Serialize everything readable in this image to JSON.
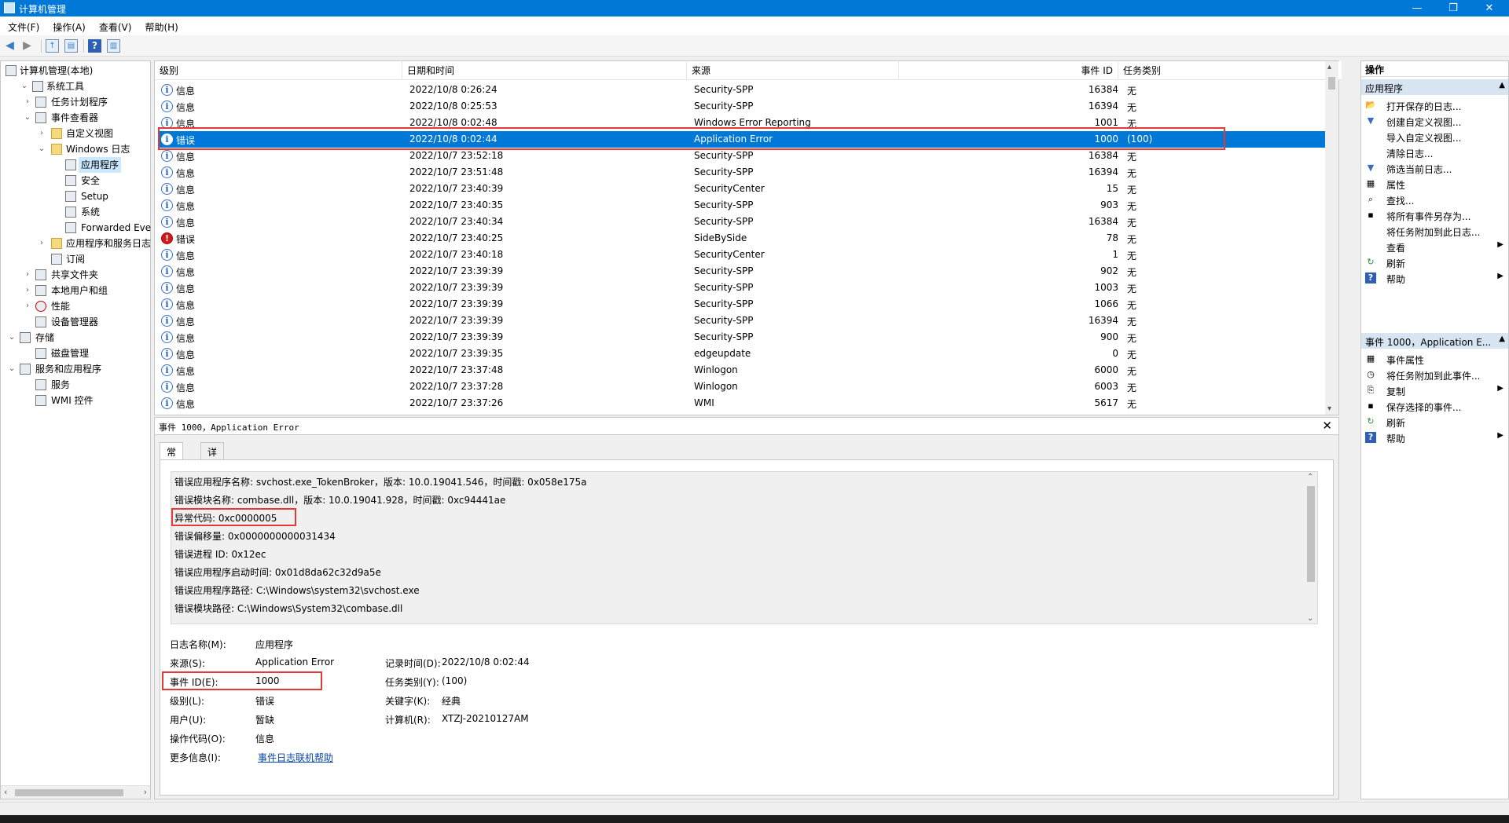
{
  "window": {
    "title": "计算机管理",
    "minimize_glyph": "—",
    "restore_glyph": "❐",
    "close_glyph": "✕"
  },
  "menu": [
    "文件(F)",
    "操作(A)",
    "查看(V)",
    "帮助(H)"
  ],
  "tree": {
    "items": [
      {
        "label": "计算机管理(本地)",
        "icon": "computer-management-icon"
      },
      {
        "label": "系统工具",
        "icon": "tools-icon"
      },
      {
        "label": "任务计划程序",
        "icon": "task-scheduler-icon"
      },
      {
        "label": "事件查看器",
        "icon": "event-viewer-icon"
      },
      {
        "label": "自定义视图",
        "icon": "folder-icon"
      },
      {
        "label": "Windows 日志",
        "icon": "folder-icon"
      },
      {
        "label": "应用程序",
        "icon": "log-icon"
      },
      {
        "label": "安全",
        "icon": "log-icon"
      },
      {
        "label": "Setup",
        "icon": "log-icon"
      },
      {
        "label": "系统",
        "icon": "log-icon"
      },
      {
        "label": "Forwarded Eve",
        "icon": "log-icon"
      },
      {
        "label": "应用程序和服务日志",
        "icon": "folder-icon"
      },
      {
        "label": "订阅",
        "icon": "subscription-icon"
      },
      {
        "label": "共享文件夹",
        "icon": "shared-folder-icon"
      },
      {
        "label": "本地用户和组",
        "icon": "users-icon"
      },
      {
        "label": "性能",
        "icon": "performance-icon"
      },
      {
        "label": "设备管理器",
        "icon": "device-manager-icon"
      },
      {
        "label": "存储",
        "icon": "storage-icon"
      },
      {
        "label": "磁盘管理",
        "icon": "disk-icon"
      },
      {
        "label": "服务和应用程序",
        "icon": "services-apps-icon"
      },
      {
        "label": "服务",
        "icon": "services-icon"
      },
      {
        "label": "WMI 控件",
        "icon": "wmi-icon"
      }
    ]
  },
  "event_list": {
    "columns": [
      "级别",
      "日期和时间",
      "来源",
      "事件 ID",
      "任务类别"
    ],
    "rows": [
      {
        "level": "信息",
        "type": "info",
        "date": "2022/10/8 0:26:24",
        "source": "Security-SPP",
        "id": "16384",
        "task": "无"
      },
      {
        "level": "信息",
        "type": "info",
        "date": "2022/10/8 0:25:53",
        "source": "Security-SPP",
        "id": "16394",
        "task": "无"
      },
      {
        "level": "信息",
        "type": "info",
        "date": "2022/10/8 0:02:48",
        "source": "Windows Error Reporting",
        "id": "1001",
        "task": "无"
      },
      {
        "level": "错误",
        "type": "info",
        "date": "2022/10/8 0:02:44",
        "source": "Application Error",
        "id": "1000",
        "task": "(100)",
        "selected": true
      },
      {
        "level": "信息",
        "type": "info",
        "date": "2022/10/7 23:52:18",
        "source": "Security-SPP",
        "id": "16384",
        "task": "无"
      },
      {
        "level": "信息",
        "type": "info",
        "date": "2022/10/7 23:51:48",
        "source": "Security-SPP",
        "id": "16394",
        "task": "无"
      },
      {
        "level": "信息",
        "type": "info",
        "date": "2022/10/7 23:40:39",
        "source": "SecurityCenter",
        "id": "15",
        "task": "无"
      },
      {
        "level": "信息",
        "type": "info",
        "date": "2022/10/7 23:40:35",
        "source": "Security-SPP",
        "id": "903",
        "task": "无"
      },
      {
        "level": "信息",
        "type": "info",
        "date": "2022/10/7 23:40:34",
        "source": "Security-SPP",
        "id": "16384",
        "task": "无"
      },
      {
        "level": "错误",
        "type": "error",
        "date": "2022/10/7 23:40:25",
        "source": "SideBySide",
        "id": "78",
        "task": "无"
      },
      {
        "level": "信息",
        "type": "info",
        "date": "2022/10/7 23:40:18",
        "source": "SecurityCenter",
        "id": "1",
        "task": "无"
      },
      {
        "level": "信息",
        "type": "info",
        "date": "2022/10/7 23:39:39",
        "source": "Security-SPP",
        "id": "902",
        "task": "无"
      },
      {
        "level": "信息",
        "type": "info",
        "date": "2022/10/7 23:39:39",
        "source": "Security-SPP",
        "id": "1003",
        "task": "无"
      },
      {
        "level": "信息",
        "type": "info",
        "date": "2022/10/7 23:39:39",
        "source": "Security-SPP",
        "id": "1066",
        "task": "无"
      },
      {
        "level": "信息",
        "type": "info",
        "date": "2022/10/7 23:39:39",
        "source": "Security-SPP",
        "id": "16394",
        "task": "无"
      },
      {
        "level": "信息",
        "type": "info",
        "date": "2022/10/7 23:39:39",
        "source": "Security-SPP",
        "id": "900",
        "task": "无"
      },
      {
        "level": "信息",
        "type": "info",
        "date": "2022/10/7 23:39:35",
        "source": "edgeupdate",
        "id": "0",
        "task": "无"
      },
      {
        "level": "信息",
        "type": "info",
        "date": "2022/10/7 23:37:48",
        "source": "Winlogon",
        "id": "6000",
        "task": "无"
      },
      {
        "level": "信息",
        "type": "info",
        "date": "2022/10/7 23:37:28",
        "source": "Winlogon",
        "id": "6003",
        "task": "无"
      },
      {
        "level": "信息",
        "type": "info",
        "date": "2022/10/7 23:37:26",
        "source": "WMI",
        "id": "5617",
        "task": "无"
      }
    ]
  },
  "detail": {
    "title": "事件 1000，Application Error",
    "tabs": [
      "常规",
      "详细信息"
    ],
    "message_lines": [
      "错误应用程序名称: svchost.exe_TokenBroker，版本: 10.0.19041.546，时间戳: 0x058e175a",
      "错误模块名称: combase.dll，版本: 10.0.19041.928，时间戳: 0xc94441ae",
      "异常代码: 0xc0000005",
      "错误偏移量: 0x0000000000031434",
      "错误进程 ID: 0x12ec",
      "错误应用程序启动时间: 0x01d8da62c32d9a5e",
      "错误应用程序路径: C:\\Windows\\system32\\svchost.exe",
      "错误模块路径: C:\\Windows\\System32\\combase.dll"
    ],
    "props": {
      "log_name_label": "日志名称(M):",
      "log_name": "应用程序",
      "source_label": "来源(S):",
      "source": "Application Error",
      "logged_label": "记录时间(D):",
      "logged": "2022/10/8 0:02:44",
      "event_id_label": "事件 ID(E):",
      "event_id": "1000",
      "task_label": "任务类别(Y):",
      "task": "(100)",
      "level_label": "级别(L):",
      "level": "错误",
      "keywords_label": "关键字(K):",
      "keywords": "经典",
      "user_label": "用户(U):",
      "user": "暂缺",
      "computer_label": "计算机(R):",
      "computer": "XTZJ-20210127AM",
      "opcode_label": "操作代码(O):",
      "opcode": "信息",
      "more_info_label": "更多信息(I):",
      "more_info_link": "事件日志联机帮助"
    }
  },
  "actions": {
    "header": "操作",
    "section1": "应用程序",
    "section1_items": [
      {
        "label": "打开保存的日志...",
        "icon": "open-log-icon"
      },
      {
        "label": "创建自定义视图...",
        "icon": "filter-create-icon"
      },
      {
        "label": "导入自定义视图...",
        "icon": ""
      },
      {
        "label": "清除日志...",
        "icon": ""
      },
      {
        "label": "筛选当前日志...",
        "icon": "filter-icon"
      },
      {
        "label": "属性",
        "icon": "properties-icon"
      },
      {
        "label": "查找...",
        "icon": "find-icon"
      },
      {
        "label": "将所有事件另存为...",
        "icon": "save-icon"
      },
      {
        "label": "将任务附加到此日志...",
        "icon": ""
      },
      {
        "label": "查看",
        "icon": "",
        "submenu": true
      },
      {
        "label": "刷新",
        "icon": "refresh-icon"
      },
      {
        "label": "帮助",
        "icon": "help-icon",
        "submenu": true
      }
    ],
    "section2": "事件 1000，Application E...",
    "section2_items": [
      {
        "label": "事件属性",
        "icon": "event-properties-icon"
      },
      {
        "label": "将任务附加到此事件...",
        "icon": "attach-task-icon"
      },
      {
        "label": "复制",
        "icon": "copy-icon",
        "submenu": true
      },
      {
        "label": "保存选择的事件...",
        "icon": "save-icon"
      },
      {
        "label": "刷新",
        "icon": "refresh-icon"
      },
      {
        "label": "帮助",
        "icon": "help-icon",
        "submenu": true
      }
    ]
  },
  "colors": {
    "selection": "#0078d7",
    "highlight_box": "#e53935",
    "section_header": "#d7e4f2"
  }
}
